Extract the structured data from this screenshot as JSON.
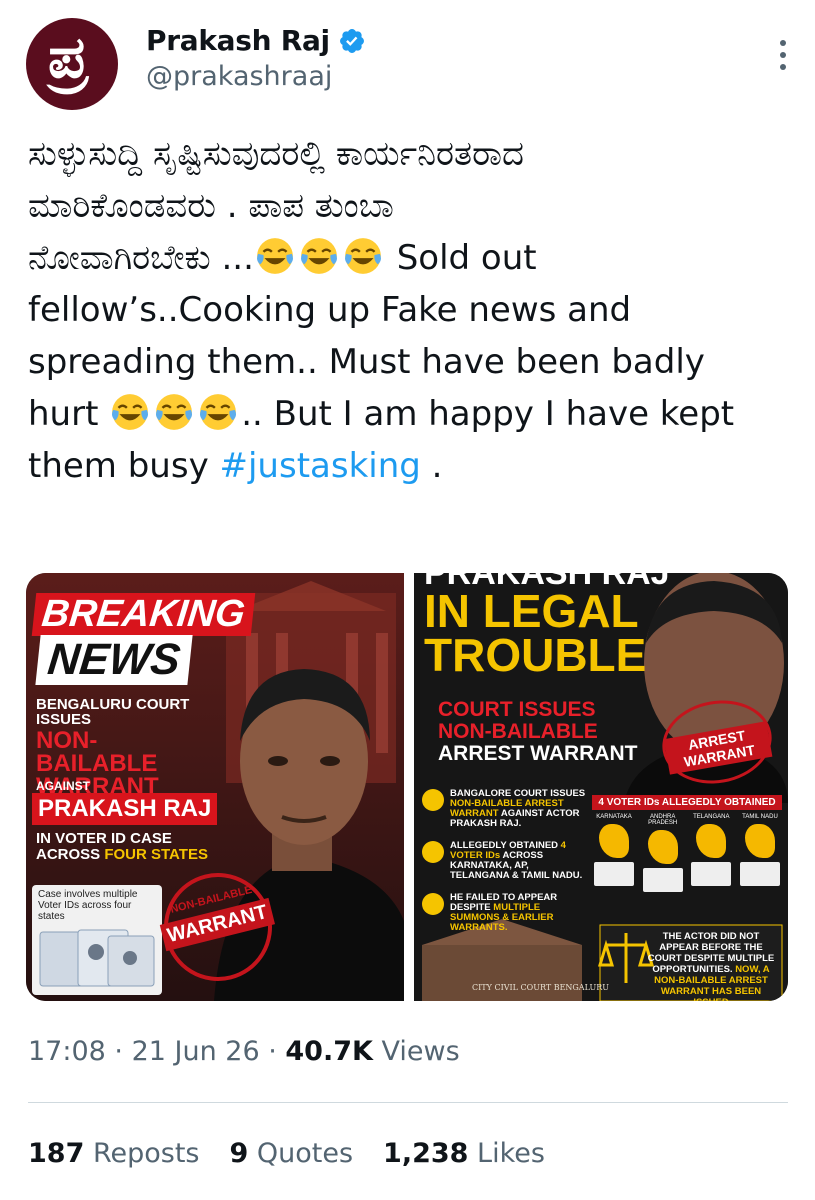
{
  "author": {
    "display_name": "Prakash Raj",
    "handle": "@prakashraaj",
    "avatar_glyph": "ಪ್ರ",
    "verified": true,
    "accent_color": "#1d9bf0"
  },
  "tweet": {
    "line1": "ಸುಳ್ಳುಸುದ್ದಿ ಸೃಷ್ಟಿಸುವುದರಲ್ಲಿ ಕಾರ್ಯನಿರತರಾದ",
    "line2": "ಮಾರಿಕೊಂಡವರು . ಪಾಪ ತುಂಬಾ",
    "line3_text": "ನೋವಾಗಿರಬೇಕು ...",
    "line3_tail": " Sold out",
    "line4": "fellow’s..Cooking up Fake news and",
    "line5": "spreading them.. Must have been badly",
    "line6_head": "hurt ",
    "line6_tail": ".. But I am happy I have kept",
    "line7_head": "them busy ",
    "hashtag": "#justasking",
    "line7_tail": " .",
    "emoji_name": "face-with-tears-of-joy-icon"
  },
  "media": {
    "left": {
      "breaking": "BREAKING",
      "news": "NEWS",
      "line_a": "BENGALURU COURT ISSUES",
      "line_b": "NON-BAILABLE WARRANT",
      "line_c": "AGAINST",
      "line_d": "PRAKASH RAJ",
      "line_e1": "IN VOTER ID CASE ACROSS ",
      "line_e2": "FOUR STATES",
      "card_text": "Case involves multiple Voter IDs across four states",
      "stamp_top": "NON-BAILABLE",
      "stamp_main": "WARRANT"
    },
    "right": {
      "head1": "PRAKASH RAJ",
      "head2": "IN LEGAL",
      "head3": "TROUBLE",
      "court1": "COURT ISSUES",
      "court2": "NON-BAILABLE",
      "court3": "ARREST WARRANT",
      "stamp": "ARREST WARRANT",
      "item1_a": "BANGALORE COURT ISSUES ",
      "item1_b": "NON-BAILABLE ARREST WARRANT",
      "item1_c": " AGAINST ACTOR PRAKASH RAJ.",
      "item2_a": "ALLEGEDLY OBTAINED ",
      "item2_b": "4 VOTER IDs",
      "item2_c": " ACROSS KARNATAKA, AP, TELANGANA & TAMIL NADU.",
      "item3_a": "HE FAILED TO APPEAR DESPITE ",
      "item3_b": "MULTIPLE SUMMONS & EARLIER WARRANTS.",
      "voter_title": "4 VOTER IDs ALLEGEDLY OBTAINED",
      "states": [
        "KARNATAKA",
        "ANDHRA PRADESH",
        "TELANGANA",
        "TAMIL NADU"
      ],
      "bottom_a": "THE ACTOR DID NOT APPEAR BEFORE THE COURT DESPITE MULTIPLE OPPORTUNITIES. ",
      "bottom_b": "NOW, A NON-BAILABLE ARREST WARRANT HAS BEEN ISSUED",
      "building_label": "CITY CIVIL COURT BENGALURU"
    }
  },
  "meta": {
    "time": "17:08",
    "separator": " · ",
    "date": "21 Jun 26",
    "views_count": "40.7K",
    "views_label": " Views"
  },
  "stats": {
    "reposts_count": "187",
    "reposts_label": " Reposts",
    "quotes_count": "9",
    "quotes_label": " Quotes",
    "likes_count": "1,238",
    "likes_label": " Likes"
  }
}
